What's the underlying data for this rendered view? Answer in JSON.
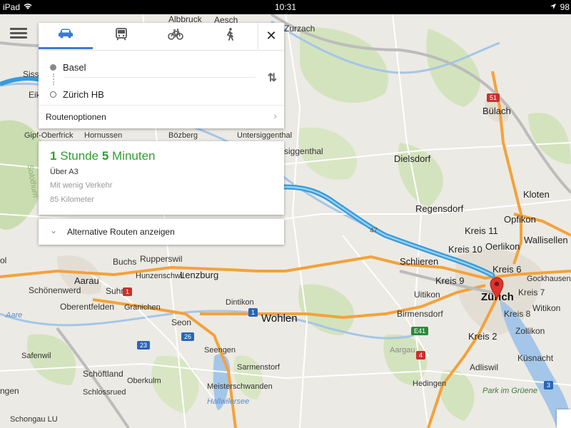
{
  "status_bar": {
    "carrier": "iPad",
    "wifi_icon": "wifi-icon",
    "time": "10:31",
    "location_icon": "location-arrow-icon",
    "battery": "98"
  },
  "directions": {
    "modes": [
      {
        "name": "car-icon",
        "active": true
      },
      {
        "name": "train-icon",
        "active": false
      },
      {
        "name": "bicycle-icon",
        "active": false
      },
      {
        "name": "walk-icon",
        "active": false
      }
    ],
    "close_label": "✕",
    "start": "Basel",
    "destination": "Zürich HB",
    "swap_label": "⇅",
    "route_options_label": "Routenoptionen",
    "chevron": "›"
  },
  "result": {
    "duration_hours_value": "1",
    "duration_hours_unit": "Stunde",
    "duration_minutes_value": "5",
    "duration_minutes_unit": "Minuten",
    "via": "Über A3",
    "traffic": "Mit wenig Verkehr",
    "distance": "85 Kilometer",
    "alternatives_label": "Alternative Routen anzeigen",
    "alternatives_chevron": "⌄"
  },
  "map": {
    "accent_route": "#3a9ad9",
    "route_highlight": "#8fd3f5",
    "highway_color": "#f3a23b",
    "water_color": "#a4c6e8",
    "labels": {
      "sissel": "Sissel",
      "eike": "Eike",
      "zurzach": "Zurzach",
      "albbruck": "Albbruck",
      "bulach": "Bülach",
      "gipf": "Gipf-Oberfrick",
      "hornussen": "Hornussen",
      "bozberg": "Bözberg",
      "untersigg": "Untersiggenthal",
      "siggenthal": "siggenthal",
      "dielsdorf": "Dielsdorf",
      "kloten": "Kloten",
      "regensdorf": "Regensdorf",
      "opfikon": "Opfikon",
      "kreis11": "Kreis 11",
      "wallisellen": "Wallisellen",
      "kreis10": "Kreis 10",
      "oerlikon": "Oerlikon",
      "schlieren": "Schlieren",
      "kreis6": "Kreis 6",
      "kreis9": "Kreis 9",
      "gockhausen": "Gockhausen",
      "uitikon": "Uitikon",
      "zurich": "Zürich",
      "kreis7": "Kreis 7",
      "kreis8": "Kreis 8",
      "birmensdorf": "Birmensdorf",
      "witikon": "Witikon",
      "zollikon": "Zollikon",
      "kreis2": "Kreis 2",
      "aargau": "Aargau",
      "kusnacht": "Küsnacht",
      "adliswil": "Adliswil",
      "hedingen": "Hedingen",
      "park": "Park im Grüene",
      "aarau": "Aarau",
      "buchs": "Buchs",
      "rupperswil": "Rupperswil",
      "hunzenschwil": "Hunzenschwil",
      "lenzburg": "Lenzburg",
      "schonenwerd": "Schönenwerd",
      "suhr": "Suhr",
      "oberentfelden": "Oberentfelden",
      "granichen": "Gränichen",
      "dintikon": "Dintikon",
      "wohlen": "Wohlen",
      "aare": "Aare",
      "seon": "Seon",
      "safenwil": "Safenwil",
      "seengen": "Seengen",
      "sarmenstorf": "Sarmenstorf",
      "schoftland": "Schöftland",
      "oberkulm": "Oberkulm",
      "meisterschwanden": "Meisterschwanden",
      "ngen": "ngen",
      "schlossrued": "Schlossrued",
      "hallwilersee": "Hallwilersee",
      "schongau": "Schongau LU",
      "ol": "ol",
      "solothurn": "Solothurn",
      "aesch": "Aesch"
    },
    "shields": {
      "s51": "51",
      "s1a": "1",
      "s1b": "1",
      "s26": "26",
      "s23": "23",
      "s4": "4",
      "e41": "E41",
      "a47": "47",
      "s3": "3"
    }
  }
}
